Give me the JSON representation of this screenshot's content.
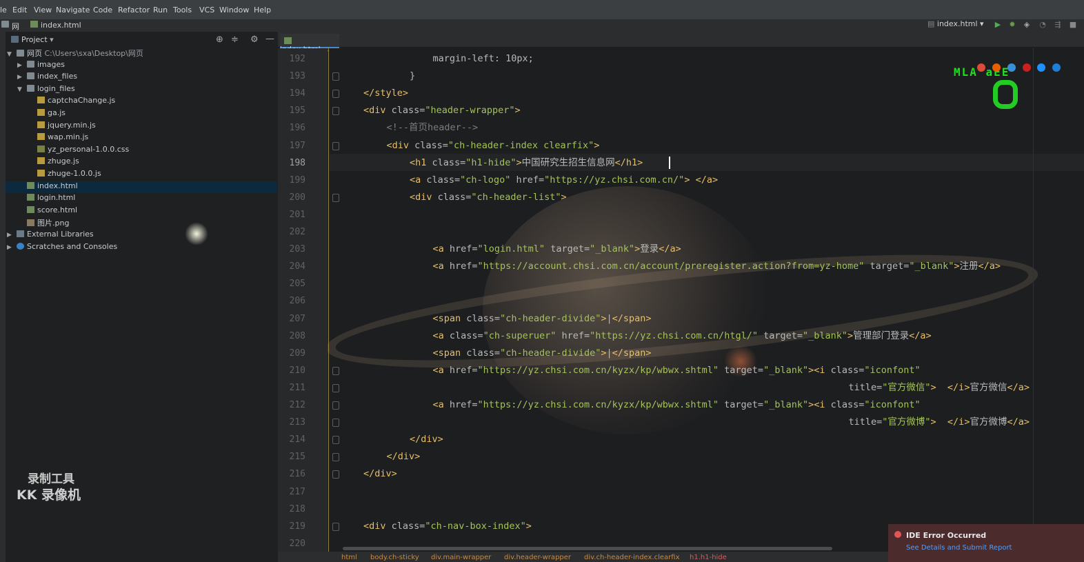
{
  "menubar": {
    "items": [
      "le",
      "Edit",
      "View",
      "Navigate",
      "Code",
      "Refactor",
      "Run",
      "Tools",
      "VCS",
      "Window",
      "Help"
    ]
  },
  "navbar": {
    "root": "网页",
    "file": "index.html"
  },
  "project": {
    "title": "Project",
    "tree": [
      {
        "label": "网页",
        "extra": "C:\\Users\\sxa\\Desktop\\网页",
        "kind": "folder",
        "level": 0,
        "arrow": "down"
      },
      {
        "label": "images",
        "kind": "folder",
        "level": 1,
        "arrow": "right"
      },
      {
        "label": "index_files",
        "kind": "folder",
        "level": 1,
        "arrow": "right"
      },
      {
        "label": "login_files",
        "kind": "folder",
        "level": 1,
        "arrow": "down"
      },
      {
        "label": "captchaChange.js",
        "kind": "js",
        "level": 2
      },
      {
        "label": "ga.js",
        "kind": "js",
        "level": 2
      },
      {
        "label": "jquery.min.js",
        "kind": "js",
        "level": 2
      },
      {
        "label": "wap.min.js",
        "kind": "js",
        "level": 2
      },
      {
        "label": "yz_personal-1.0.0.css",
        "kind": "css",
        "level": 2
      },
      {
        "label": "zhuge.js",
        "kind": "js",
        "level": 2
      },
      {
        "label": "zhuge-1.0.0.js",
        "kind": "js",
        "level": 2
      },
      {
        "label": "index.html",
        "kind": "html",
        "level": 1,
        "selected": true
      },
      {
        "label": "login.html",
        "kind": "html",
        "level": 1
      },
      {
        "label": "score.html",
        "kind": "html",
        "level": 1
      },
      {
        "label": "图片.png",
        "kind": "png",
        "level": 1
      },
      {
        "label": "External Libraries",
        "kind": "lib",
        "level": 0,
        "arrow": "right"
      },
      {
        "label": "Scratches and Consoles",
        "kind": "scratch",
        "level": 0,
        "arrow": "right"
      }
    ]
  },
  "editor": {
    "tab_label": "index.html",
    "current_line": 198,
    "lines": [
      {
        "n": 192,
        "indent": 3,
        "parts": [
          [
            "attr",
            "margin-left: 10px;"
          ]
        ]
      },
      {
        "n": 193,
        "indent": 2,
        "parts": [
          [
            "attr",
            "}"
          ]
        ]
      },
      {
        "n": 194,
        "indent": 0,
        "parts": [
          [
            "tag",
            "</style>"
          ]
        ]
      },
      {
        "n": 195,
        "indent": 0,
        "parts": [
          [
            "tag",
            "<div "
          ],
          [
            "attr",
            "class="
          ],
          [
            "str",
            "\"header-wrapper\""
          ],
          [
            "tag",
            ">"
          ]
        ]
      },
      {
        "n": 196,
        "indent": 1,
        "parts": [
          [
            "cm",
            "<!--首页header-->"
          ]
        ]
      },
      {
        "n": 197,
        "indent": 1,
        "parts": [
          [
            "tag",
            "<div "
          ],
          [
            "attr",
            "class="
          ],
          [
            "str",
            "\"ch-header-index clearfix\""
          ],
          [
            "tag",
            ">"
          ]
        ]
      },
      {
        "n": 198,
        "indent": 2,
        "parts": [
          [
            "tag",
            "<h1 "
          ],
          [
            "attr",
            "class="
          ],
          [
            "str",
            "\"h1-hide\""
          ],
          [
            "tag",
            ">"
          ],
          [
            "attr",
            "中国研究生招生信息网"
          ],
          [
            "tag",
            "</h1>"
          ]
        ]
      },
      {
        "n": 199,
        "indent": 2,
        "parts": [
          [
            "tag",
            "<a "
          ],
          [
            "attr",
            "class="
          ],
          [
            "str",
            "\"ch-logo\""
          ],
          [
            "attr",
            " href="
          ],
          [
            "str",
            "\"https://yz.chsi.com.cn/\""
          ],
          [
            "tag",
            "> </a>"
          ]
        ]
      },
      {
        "n": 200,
        "indent": 2,
        "parts": [
          [
            "tag",
            "<div "
          ],
          [
            "attr",
            "class="
          ],
          [
            "str",
            "\"ch-header-list\""
          ],
          [
            "tag",
            ">"
          ]
        ]
      },
      {
        "n": 201,
        "indent": 0,
        "parts": []
      },
      {
        "n": 202,
        "indent": 0,
        "parts": []
      },
      {
        "n": 203,
        "indent": 3,
        "parts": [
          [
            "tag",
            "<a "
          ],
          [
            "attr",
            "href="
          ],
          [
            "str",
            "\"login.html\""
          ],
          [
            "attr",
            " target="
          ],
          [
            "str",
            "\"_blank\""
          ],
          [
            "tag",
            ">"
          ],
          [
            "attr",
            "登录"
          ],
          [
            "tag",
            "</a>"
          ]
        ]
      },
      {
        "n": 204,
        "indent": 3,
        "parts": [
          [
            "tag",
            "<a "
          ],
          [
            "attr",
            "href="
          ],
          [
            "str",
            "\"https://account.chsi.com.cn/account/preregister.action?from=yz-home\""
          ],
          [
            "attr",
            " target="
          ],
          [
            "str",
            "\"_blank\""
          ],
          [
            "tag",
            ">"
          ],
          [
            "attr",
            "注册"
          ],
          [
            "tag",
            "</a>"
          ]
        ]
      },
      {
        "n": 205,
        "indent": 0,
        "parts": []
      },
      {
        "n": 206,
        "indent": 0,
        "parts": []
      },
      {
        "n": 207,
        "indent": 3,
        "parts": [
          [
            "tag",
            "<span "
          ],
          [
            "attr",
            "class="
          ],
          [
            "str",
            "\"ch-header-divide\""
          ],
          [
            "tag",
            ">"
          ],
          [
            "attr",
            "|"
          ],
          [
            "tag",
            "</span>"
          ]
        ]
      },
      {
        "n": 208,
        "indent": 3,
        "parts": [
          [
            "tag",
            "<a "
          ],
          [
            "attr",
            "class="
          ],
          [
            "str",
            "\"ch-superuer\""
          ],
          [
            "attr",
            " href="
          ],
          [
            "str",
            "\"https://yz.chsi.com.cn/htgl/\""
          ],
          [
            "attr",
            " target="
          ],
          [
            "str",
            "\"_blank\""
          ],
          [
            "tag",
            ">"
          ],
          [
            "attr",
            "管理部门登录"
          ],
          [
            "tag",
            "</a>"
          ]
        ]
      },
      {
        "n": 209,
        "indent": 3,
        "parts": [
          [
            "tag",
            "<span "
          ],
          [
            "attr",
            "class="
          ],
          [
            "str",
            "\"ch-header-divide\""
          ],
          [
            "tag",
            ">"
          ],
          [
            "attr",
            "|"
          ],
          [
            "tag",
            "</span>"
          ]
        ]
      },
      {
        "n": 210,
        "indent": 3,
        "parts": [
          [
            "tag",
            "<a "
          ],
          [
            "attr",
            "href="
          ],
          [
            "str",
            "\"https://yz.chsi.com.cn/kyzx/kp/wbwx.shtml\""
          ],
          [
            "attr",
            " target="
          ],
          [
            "str",
            "\"_blank\""
          ],
          [
            "tag",
            "><i "
          ],
          [
            "attr",
            "class="
          ],
          [
            "str",
            "\"iconfont\""
          ]
        ]
      },
      {
        "n": 211,
        "indent": 21,
        "parts": [
          [
            "attr",
            "title="
          ],
          [
            "str",
            "\"官方微信\""
          ],
          [
            "tag",
            ">  </i>"
          ],
          [
            "attr",
            "官方微信"
          ],
          [
            "tag",
            "</a>"
          ]
        ]
      },
      {
        "n": 212,
        "indent": 3,
        "parts": [
          [
            "tag",
            "<a "
          ],
          [
            "attr",
            "href="
          ],
          [
            "str",
            "\"https://yz.chsi.com.cn/kyzx/kp/wbwx.shtml\""
          ],
          [
            "attr",
            " target="
          ],
          [
            "str",
            "\"_blank\""
          ],
          [
            "tag",
            "><i "
          ],
          [
            "attr",
            "class="
          ],
          [
            "str",
            "\"iconfont\""
          ]
        ]
      },
      {
        "n": 213,
        "indent": 21,
        "parts": [
          [
            "attr",
            "title="
          ],
          [
            "str",
            "\"官方微博\""
          ],
          [
            "tag",
            ">  </i>"
          ],
          [
            "attr",
            "官方微博"
          ],
          [
            "tag",
            "</a>"
          ]
        ]
      },
      {
        "n": 214,
        "indent": 2,
        "parts": [
          [
            "tag",
            "</div>"
          ]
        ]
      },
      {
        "n": 215,
        "indent": 1,
        "parts": [
          [
            "tag",
            "</div>"
          ]
        ]
      },
      {
        "n": 216,
        "indent": 0,
        "parts": [
          [
            "tag",
            "</div>"
          ]
        ]
      },
      {
        "n": 217,
        "indent": 0,
        "parts": []
      },
      {
        "n": 218,
        "indent": 0,
        "parts": []
      },
      {
        "n": 219,
        "indent": 0,
        "parts": [
          [
            "tag",
            "<div "
          ],
          [
            "attr",
            "class="
          ],
          [
            "str",
            "\"ch-nav-box-index\""
          ],
          [
            "tag",
            ">"
          ]
        ]
      },
      {
        "n": 220,
        "indent": 0,
        "parts": []
      }
    ],
    "fold_lines": [
      193,
      194,
      195,
      197,
      200,
      210,
      211,
      212,
      213,
      214,
      215,
      216,
      219
    ]
  },
  "breadcrumb": [
    "html",
    "body.ch-sticky",
    "div.main-wrapper",
    "div.header-wrapper",
    "div.ch-header-index.clearfix",
    "h1.h1-hide"
  ],
  "toolbar": {
    "run_config": "index.html"
  },
  "notification": {
    "title": "IDE Error Occurred",
    "link": "See Details and Submit Report"
  },
  "watermark": {
    "line1": "录制工具",
    "line2": "KK 录像机"
  },
  "overlay": {
    "green_text": "MLA  aEE"
  },
  "colors": {
    "tag": "#e8bf6a",
    "string": "#a5c25c",
    "comment": "#7a7e7f",
    "selection": "#0d293e",
    "error_bg": "#4b2b2b"
  }
}
